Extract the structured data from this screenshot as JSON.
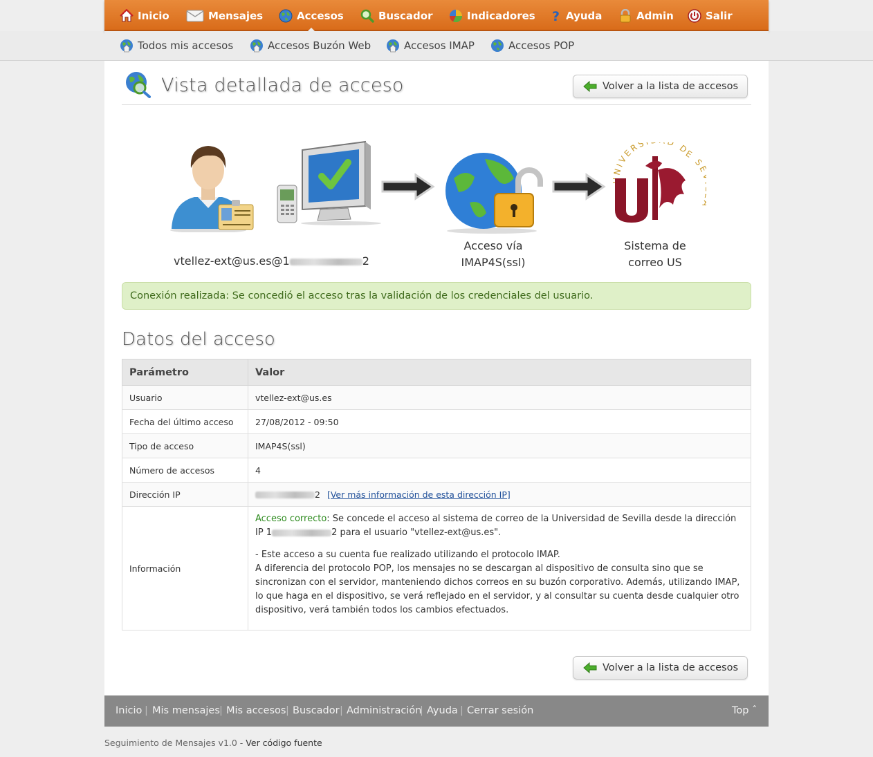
{
  "nav": {
    "items": [
      {
        "label": "Inicio",
        "icon": "home-icon"
      },
      {
        "label": "Mensajes",
        "icon": "envelope-icon"
      },
      {
        "label": "Accesos",
        "icon": "globe-icon",
        "active": true
      },
      {
        "label": "Buscador",
        "icon": "magnifier-icon"
      },
      {
        "label": "Indicadores",
        "icon": "pie-chart-icon"
      },
      {
        "label": "Ayuda",
        "icon": "help-icon"
      },
      {
        "label": "Admin",
        "icon": "padlock-icon"
      },
      {
        "label": "Salir",
        "icon": "power-icon"
      }
    ]
  },
  "subnav": {
    "items": [
      {
        "label": "Todos mis accesos"
      },
      {
        "label": "Accesos Buzón Web"
      },
      {
        "label": "Accesos IMAP"
      },
      {
        "label": "Accesos POP"
      }
    ]
  },
  "page": {
    "title": "Vista detallada de acceso",
    "back_label": "Volver a la lista de accesos"
  },
  "diagram": {
    "user_label": "vtellez-ext@us.es@1",
    "user_label_tail": "2",
    "access_line1": "Acceso vía",
    "access_line2": "IMAP4S(ssl)",
    "system_line1": "Sistema de",
    "system_line2": "correo US",
    "logo_text": "UNIVERSIDAD DE SEVILLA"
  },
  "alert": {
    "text": "Conexión realizada: Se concedió el acceso tras la validación de los credenciales del usuario."
  },
  "section": {
    "title": "Datos del acceso"
  },
  "table": {
    "headers": [
      "Parámetro",
      "Valor"
    ],
    "rows": [
      {
        "param": "Usuario",
        "value": "vtellez-ext@us.es"
      },
      {
        "param": "Fecha del último acceso",
        "value": "27/08/2012 - 09:50"
      },
      {
        "param": "Tipo de acceso",
        "value": "IMAP4S(ssl)"
      },
      {
        "param": "Número de accesos",
        "value": "4"
      },
      {
        "param": "Dirección IP",
        "value_tail": "2",
        "link": "[Ver más información de esta dirección IP]"
      }
    ],
    "info": {
      "param": "Información",
      "ok": "Acceso correcto",
      "line1": ": Se concede el acceso al sistema de correo de la Universidad de Sevilla desde la dirección",
      "line2_pre": "IP 1",
      "line2_post": "2 para el usuario \"vtellez-ext@us.es\".",
      "p2_1": "- Este acceso a su cuenta fue realizado utilizando el protocolo IMAP.",
      "p2_2": "A diferencia del protocolo POP, los mensajes no se descargan al dispositivo de consulta sino que se sincronizan con el servidor, manteniendo dichos correos en su buzón corporativo. Además, utilizando IMAP, lo que haga en el dispositivo, se verá reflejado en el servidor, y al consultar su cuenta desde cualquier otro dispositivo, verá también todos los cambios efectuados."
    }
  },
  "footer": {
    "links": [
      "Inicio",
      "Mis mensajes",
      "Mis accesos",
      "Buscador",
      "Administración",
      "Ayuda",
      "Cerrar sesión"
    ],
    "top": "Top ˆ"
  },
  "bottom_note": {
    "text": "Seguimiento de Mensajes v1.0 - ",
    "link": "Ver código fuente"
  }
}
